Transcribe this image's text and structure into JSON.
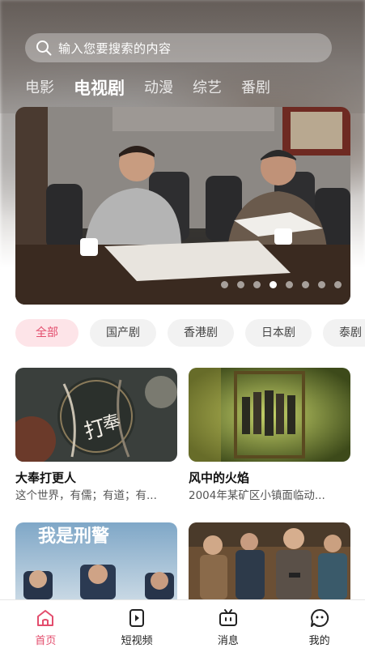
{
  "search": {
    "placeholder": "输入您要搜索的内容"
  },
  "tabs": [
    {
      "label": "电影",
      "active": false
    },
    {
      "label": "电视剧",
      "active": true
    },
    {
      "label": "动漫",
      "active": false
    },
    {
      "label": "综艺",
      "active": false
    },
    {
      "label": "番剧",
      "active": false
    }
  ],
  "banner": {
    "page_count": 8,
    "active_index": 3
  },
  "chips": [
    "全部",
    "国产剧",
    "香港剧",
    "日本剧",
    "泰剧"
  ],
  "cards": [
    {
      "title": "大奉打更人",
      "desc": "这个世界，有儒；有道；有..."
    },
    {
      "title": "风中的火焰",
      "desc": "2004年某矿区小镇面临动..."
    },
    {
      "title": "",
      "desc": ""
    },
    {
      "title": "",
      "desc": ""
    }
  ],
  "card_poster_texts": {
    "poster_3_title": "我是刑警"
  },
  "bottom_nav": [
    {
      "label": "首页",
      "icon": "home-icon",
      "active": true
    },
    {
      "label": "短视频",
      "icon": "short-video-icon",
      "active": false
    },
    {
      "label": "消息",
      "icon": "message-icon",
      "active": false
    },
    {
      "label": "我的",
      "icon": "profile-icon",
      "active": false
    }
  ],
  "colors": {
    "accent": "#e34d6d",
    "chip_active_bg": "#fde4e8",
    "chip_bg": "#f2f2f2"
  }
}
